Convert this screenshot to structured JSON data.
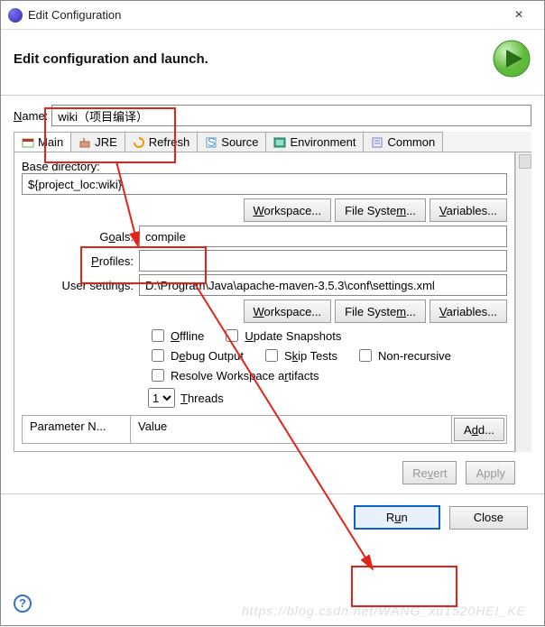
{
  "window": {
    "title": "Edit Configuration",
    "close": "×"
  },
  "header": {
    "text": "Edit configuration and launch."
  },
  "name": {
    "label": "Name:",
    "value": "wiki（项目编译）"
  },
  "tabs": {
    "main": "Main",
    "jre": "JRE",
    "refresh": "Refresh",
    "source": "Source",
    "environment": "Environment",
    "common": "Common"
  },
  "basedir": {
    "label": "Base directory:",
    "value": "${project_loc:wiki}"
  },
  "buttons": {
    "workspace": "Workspace...",
    "filesystem": "File System...",
    "variables": "Variables...",
    "add": "Add...",
    "revert": "Revert",
    "apply": "Apply",
    "run": "Run",
    "close": "Close"
  },
  "goals": {
    "label": "Goals:",
    "value": "compile"
  },
  "profiles": {
    "label": "Profiles:",
    "value": ""
  },
  "usersettings": {
    "label": "User settings:",
    "value": "D:\\Program\\Java\\apache-maven-3.5.3\\conf\\settings.xml"
  },
  "checks": {
    "offline": "Offline",
    "update": "Update Snapshots",
    "debug": "Debug Output",
    "skip": "Skip Tests",
    "nonrec": "Non-recursive",
    "resolve": "Resolve Workspace artifacts"
  },
  "threads": {
    "value": "1",
    "label": "Threads"
  },
  "paramtable": {
    "col1": "Parameter N...",
    "col2": "Value"
  },
  "watermark": "https://blog.csdn.net/WANG_xu1520HEI_KE"
}
